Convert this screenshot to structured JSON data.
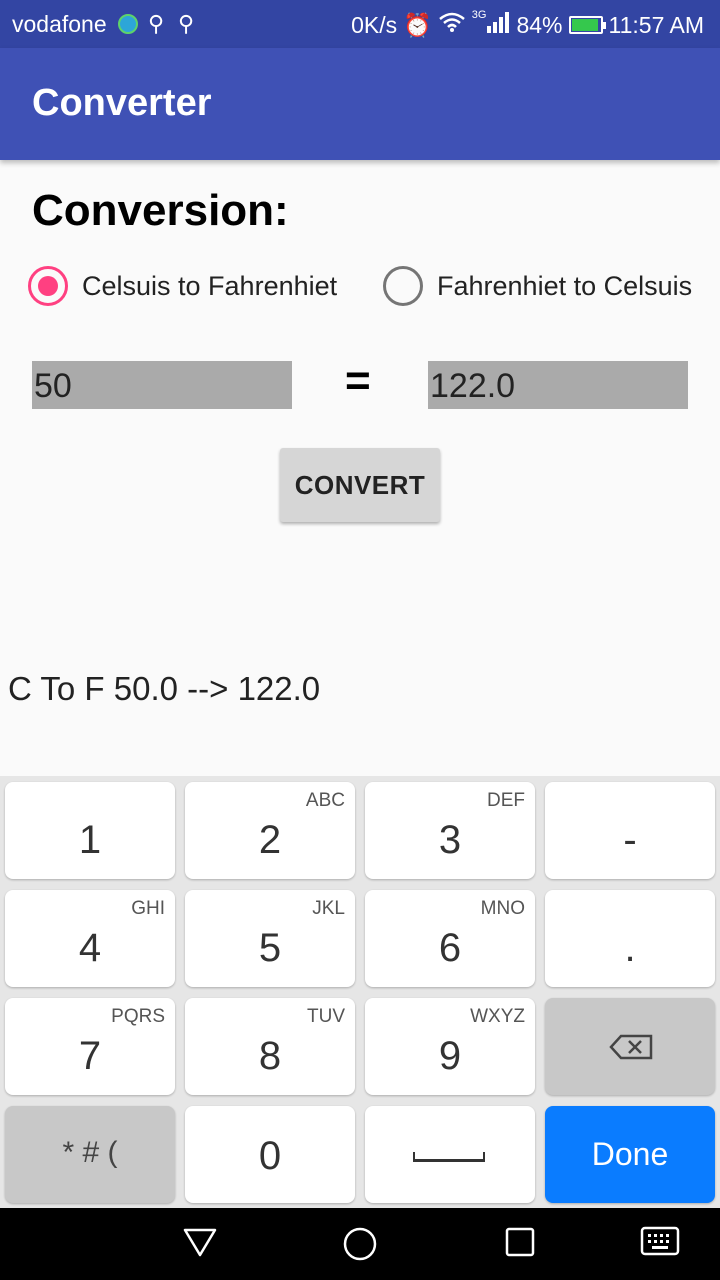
{
  "status_bar": {
    "carrier": "vodafone",
    "speed": "0K/s",
    "network": "3G",
    "battery": "84%",
    "time": "11:57 AM"
  },
  "app_bar": {
    "title": "Converter"
  },
  "content": {
    "heading": "Conversion:",
    "radio_c2f": {
      "label": "Celsuis to Fahrenhiet",
      "checked": true
    },
    "radio_f2c": {
      "label": "Fahrenhiet to Celsuis",
      "checked": false
    },
    "input_value": "50",
    "equals_sign": "=",
    "output_value": "122.0",
    "convert_button": "CONVERT",
    "result_text": "C To F 50.0 --> 122.0"
  },
  "keyboard": {
    "keys": [
      {
        "main": "1",
        "sub": ""
      },
      {
        "main": "2",
        "sub": "ABC"
      },
      {
        "main": "3",
        "sub": "DEF"
      },
      {
        "main": "-",
        "sub": ""
      },
      {
        "main": "4",
        "sub": "GHI"
      },
      {
        "main": "5",
        "sub": "JKL"
      },
      {
        "main": "6",
        "sub": "MNO"
      },
      {
        "main": ".",
        "sub": ""
      },
      {
        "main": "7",
        "sub": "PQRS"
      },
      {
        "main": "8",
        "sub": "TUV"
      },
      {
        "main": "9",
        "sub": "WXYZ"
      },
      {
        "main": "",
        "sub": "",
        "icon": "backspace-icon"
      },
      {
        "main": "* # (",
        "sub": ""
      },
      {
        "main": "0",
        "sub": ""
      },
      {
        "main": "",
        "sub": "",
        "icon": "space-icon"
      },
      {
        "main": "Done",
        "sub": ""
      }
    ]
  },
  "nav_bar": {
    "back": "back-triangle-icon",
    "home": "home-circle-icon",
    "recents": "recents-square-icon",
    "keyboard": "keyboard-icon"
  },
  "colors": {
    "status_bar": "#3345a3",
    "app_bar": "#3f51b5",
    "accent": "#ff4081",
    "done_key": "#0a7cff",
    "field_bg": "#aaaaaa"
  }
}
